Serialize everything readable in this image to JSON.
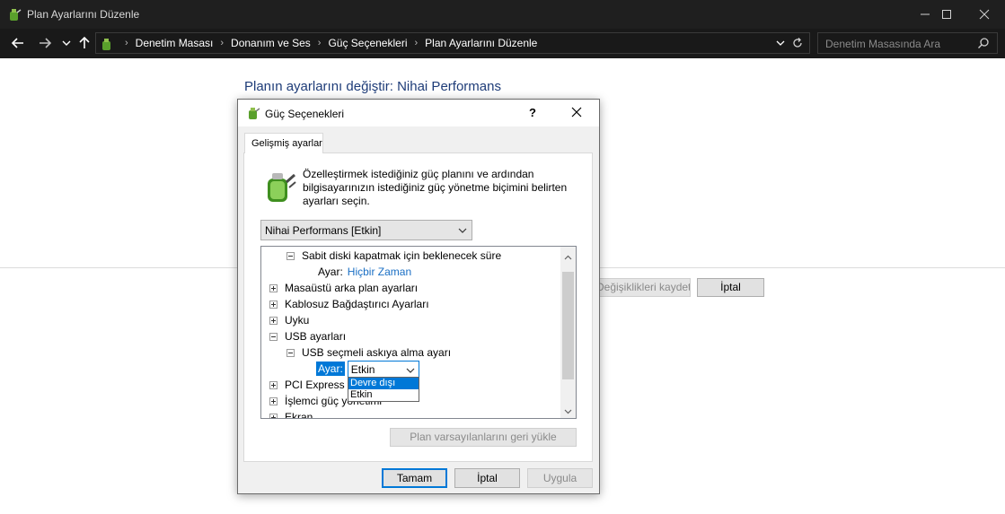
{
  "window": {
    "title": "Plan Ayarlarını Düzenle"
  },
  "address": {
    "crumbs": [
      "Denetim Masası",
      "Donanım ve Ses",
      "Güç Seçenekleri",
      "Plan Ayarlarını Düzenle"
    ],
    "search_placeholder": "Denetim Masasında Ara"
  },
  "page": {
    "heading": "Planın ayarlarını değiştir: Nihai Performans",
    "save_label": "Değişiklikleri kaydet",
    "cancel_label": "İptal"
  },
  "dialog": {
    "title": "Güç Seçenekleri",
    "help": "?",
    "tab": "Gelişmiş ayarlar",
    "description": "Özelleştirmek istediğiniz güç planını ve ardından bilgisayarınızın istediğiniz güç yönetme biçimini belirten ayarları seçin.",
    "plan_selected": "Nihai Performans [Etkin]",
    "tree": {
      "hdd_label": "Sabit diski kapatmak için beklenecek süre",
      "hdd_setting_label": "Ayar:",
      "hdd_setting_value": "Hiçbir Zaman",
      "desktop_bg": "Masaüstü arka plan ayarları",
      "wireless": "Kablosuz Bağdaştırıcı Ayarları",
      "sleep": "Uyku",
      "usb": "USB ayarları",
      "usb_selective": "USB seçmeli askıya alma ayarı",
      "usb_setting_label": "Ayar:",
      "usb_setting_value": "Etkin",
      "pci": "PCI Express",
      "cpu": "İşlemci güç yönetimi",
      "display": "Ekran"
    },
    "dropdown_options": [
      "Devre dışı",
      "Etkin"
    ],
    "restore_label": "Plan varsayılanlarını geri yükle",
    "ok_label": "Tamam",
    "cancel_label": "İptal",
    "apply_label": "Uygula"
  }
}
